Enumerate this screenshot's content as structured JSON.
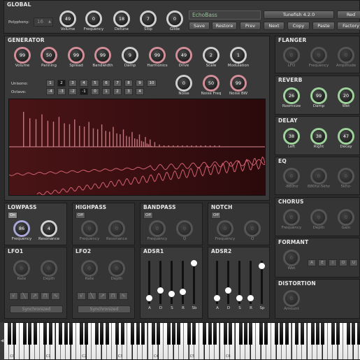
{
  "global": {
    "title": "GLOBAL",
    "polyphony_label": "Polyphony:",
    "polyphony_value": "16",
    "knobs": [
      {
        "label": "Volume",
        "value": "49"
      },
      {
        "label": "Frequency",
        "value": "0"
      },
      {
        "label": "Detune",
        "value": "18"
      },
      {
        "label": "Slop",
        "value": "7"
      },
      {
        "label": "Glide",
        "value": "0"
      }
    ],
    "patch_name": "EchoBass",
    "version_button": "Tunefish 4.2.0",
    "rec_button": "Red",
    "buttons": [
      "Save",
      "Restore",
      "Prev",
      "Next",
      "Copy",
      "Paste",
      "Factory"
    ]
  },
  "generator": {
    "title": "GENERATOR",
    "knobs": [
      {
        "label": "Volume",
        "value": "99"
      },
      {
        "label": "Panning",
        "value": "50"
      },
      {
        "label": "Spread",
        "value": "99"
      },
      {
        "label": "Bandwidth",
        "value": "99"
      },
      {
        "label": "Damp",
        "value": "9"
      },
      {
        "label": "Harmonics",
        "value": "99"
      },
      {
        "label": "Drive",
        "value": "49"
      },
      {
        "label": "Scale",
        "value": "2"
      },
      {
        "label": "Modulation",
        "value": "1"
      }
    ],
    "unisono_label": "Unisono:",
    "unisono": [
      "1",
      "2",
      "3",
      "4",
      "5",
      "6",
      "7",
      "8",
      "9",
      "10"
    ],
    "unisono_selected": "2",
    "octave_label": "Octave:",
    "octave": [
      "-4",
      "-3",
      "-2",
      "-1",
      "0",
      "1",
      "2",
      "3",
      "4"
    ],
    "octave_selected": "-1",
    "noise_knobs": [
      {
        "label": "Noise",
        "value": "0"
      },
      {
        "label": "Noise Freq",
        "value": "50"
      },
      {
        "label": "Noise BW",
        "value": "99"
      }
    ]
  },
  "flanger": {
    "title": "FLANGER",
    "knobs": [
      {
        "label": "LFO",
        "value": "0"
      },
      {
        "label": "Frequency",
        "value": "0"
      },
      {
        "label": "Amplitude",
        "value": "0"
      }
    ]
  },
  "reverb": {
    "title": "REVERB",
    "knobs": [
      {
        "label": "Roomsize",
        "value": "26"
      },
      {
        "label": "Damp",
        "value": "99"
      },
      {
        "label": "Wet",
        "value": "20"
      }
    ]
  },
  "delay": {
    "title": "DELAY",
    "knobs": [
      {
        "label": "Left",
        "value": "38"
      },
      {
        "label": "Right",
        "value": "38"
      },
      {
        "label": "Decay",
        "value": "47"
      }
    ]
  },
  "eq": {
    "title": "EQ",
    "knobs": [
      {
        "label": "-880hz",
        "value": "0"
      },
      {
        "label": "880hz-5khz",
        "value": "0"
      },
      {
        "label": "5khz-",
        "value": "0"
      }
    ]
  },
  "chorus": {
    "title": "CHORUS",
    "knobs": [
      {
        "label": "Frequency",
        "value": "0"
      },
      {
        "label": "Depth",
        "value": "0"
      },
      {
        "label": "Gain",
        "value": "0"
      }
    ]
  },
  "formant": {
    "title": "FORMANT",
    "knob": {
      "label": "Wet",
      "value": "0"
    },
    "vowels": [
      "A",
      "E",
      "I",
      "O",
      "U"
    ]
  },
  "distortion": {
    "title": "DISTORTION",
    "knob": {
      "label": "Amount",
      "value": "0"
    }
  },
  "lowpass": {
    "title": "LOWPASS",
    "toggle": "On",
    "knobs": [
      {
        "label": "Frequency",
        "value": "86"
      },
      {
        "label": "Resonance",
        "value": "4"
      }
    ]
  },
  "highpass": {
    "title": "HIGHPASS",
    "toggle": "Off",
    "knobs": [
      {
        "label": "Frequency",
        "value": "0"
      },
      {
        "label": "Resonance",
        "value": "0"
      }
    ]
  },
  "bandpass": {
    "title": "BANDPASS",
    "toggle": "Off",
    "knobs": [
      {
        "label": "Frequency",
        "value": "0"
      },
      {
        "label": "Q",
        "value": "0"
      }
    ]
  },
  "notch": {
    "title": "NOTCH",
    "toggle": "Off",
    "knobs": [
      {
        "label": "Frequency",
        "value": "0"
      },
      {
        "label": "Q",
        "value": "0"
      }
    ]
  },
  "lfo1": {
    "title": "LFO1",
    "knobs": [
      {
        "label": "Rate",
        "value": "0"
      },
      {
        "label": "Depth",
        "value": "0"
      }
    ],
    "sync": "Synchronized"
  },
  "lfo2": {
    "title": "LFO2",
    "knobs": [
      {
        "label": "Rate",
        "value": "0"
      },
      {
        "label": "Depth",
        "value": "0"
      }
    ],
    "sync": "Synchronized"
  },
  "adsr1": {
    "title": "ADSR1",
    "sliders": [
      {
        "label": "A",
        "level": 0.1
      },
      {
        "label": "D",
        "level": 0.3
      },
      {
        "label": "S",
        "level": 0.22
      },
      {
        "label": "R",
        "level": 0.26
      },
      {
        "label": "Sb",
        "level": 1.0
      }
    ]
  },
  "adsr2": {
    "title": "ADSR2",
    "sliders": [
      {
        "label": "A",
        "level": 0.1
      },
      {
        "label": "D",
        "level": 0.3
      },
      {
        "label": "S",
        "level": 0.1
      },
      {
        "label": "R",
        "level": 0.1
      },
      {
        "label": "Sp",
        "level": 0.92
      }
    ]
  },
  "keyboard": {
    "octave_labels": [
      "C0",
      "C1",
      "C2",
      "C3",
      "C4",
      "C5",
      "C6"
    ]
  },
  "colors": {
    "pink_ring": "#d38f99",
    "green_ring": "#9fd39c",
    "lavender_ring": "#a9a6d8",
    "spectrum_bg": "#3a0f12",
    "spectrum_line": "#d06070"
  }
}
